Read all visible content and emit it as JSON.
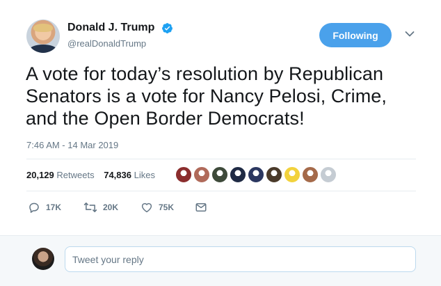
{
  "author": {
    "display_name": "Donald J. Trump",
    "handle": "@realDonaldTrump",
    "verified": true,
    "verified_color": "#1da1f2"
  },
  "follow_button": {
    "label": "Following",
    "color": "#4aa1eb"
  },
  "tweet": {
    "text": "A vote for today’s resolution by Republican Senators is a vote for Nancy Pelosi, Crime, and the Open Border Democrats!",
    "timestamp": "7:46 AM - 14 Mar 2019"
  },
  "stats": {
    "retweets_count": "20,129",
    "retweets_label": "Retweets",
    "likes_count": "74,836",
    "likes_label": "Likes"
  },
  "liker_avatars": [
    {
      "name": "liker-avatar-1",
      "color": "#8b2d2d"
    },
    {
      "name": "liker-avatar-2",
      "color": "#b06a5a"
    },
    {
      "name": "liker-avatar-3",
      "color": "#3e4a3a"
    },
    {
      "name": "liker-avatar-4",
      "color": "#1f2a44"
    },
    {
      "name": "liker-avatar-5",
      "color": "#2b3760"
    },
    {
      "name": "liker-avatar-6",
      "color": "#4a3a2a"
    },
    {
      "name": "liker-avatar-7",
      "color": "#f2d23c"
    },
    {
      "name": "liker-avatar-8",
      "color": "#a56a4a"
    },
    {
      "name": "liker-avatar-9",
      "color": "#c5ccd3"
    }
  ],
  "actions": {
    "reply_count": "17K",
    "retweet_count": "20K",
    "like_count": "75K"
  },
  "reply": {
    "placeholder": "Tweet your reply"
  },
  "icons": {
    "verified": "verified-badge-icon",
    "chevron": "chevron-down-icon",
    "reply": "reply-icon",
    "retweet": "retweet-icon",
    "like": "heart-icon",
    "dm": "envelope-icon"
  }
}
